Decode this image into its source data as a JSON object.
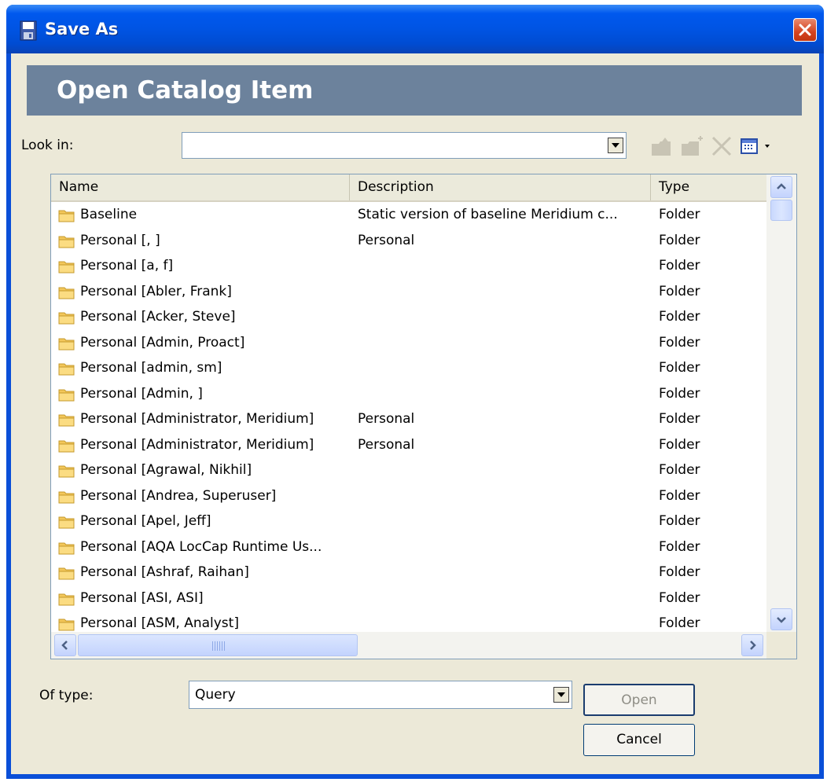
{
  "window": {
    "title": "Save As",
    "title_icon": "floppy-save-icon",
    "close_icon": "close-icon"
  },
  "header": {
    "title": "Open Catalog Item"
  },
  "lookin": {
    "label": "Look in:",
    "value": ""
  },
  "toolbar": {
    "icons": [
      "up-folder-icon",
      "new-folder-icon",
      "delete-icon",
      "view-menu-icon"
    ]
  },
  "list": {
    "columns": [
      "Name",
      "Description",
      "Type"
    ],
    "rows": [
      {
        "name": "Baseline",
        "description": "Static version of baseline Meridium c...",
        "type": "Folder"
      },
      {
        "name": "Personal [, ]",
        "description": "Personal",
        "type": "Folder"
      },
      {
        "name": "Personal [a, f]",
        "description": "",
        "type": "Folder"
      },
      {
        "name": "Personal [Abler, Frank]",
        "description": "",
        "type": "Folder"
      },
      {
        "name": "Personal [Acker, Steve]",
        "description": "",
        "type": "Folder"
      },
      {
        "name": "Personal [Admin, Proact]",
        "description": "",
        "type": "Folder"
      },
      {
        "name": "Personal [admin, sm]",
        "description": "",
        "type": "Folder"
      },
      {
        "name": "Personal [Admin, ]",
        "description": "",
        "type": "Folder"
      },
      {
        "name": "Personal [Administrator, Meridium]",
        "description": "Personal",
        "type": "Folder"
      },
      {
        "name": "Personal [Administrator, Meridium]",
        "description": "Personal",
        "type": "Folder"
      },
      {
        "name": "Personal [Agrawal, Nikhil]",
        "description": "",
        "type": "Folder"
      },
      {
        "name": "Personal [Andrea, Superuser]",
        "description": "",
        "type": "Folder"
      },
      {
        "name": "Personal [Apel, Jeff]",
        "description": "",
        "type": "Folder"
      },
      {
        "name": "Personal [AQA LocCap Runtime Us...",
        "description": "",
        "type": "Folder"
      },
      {
        "name": "Personal [Ashraf, Raihan]",
        "description": "",
        "type": "Folder"
      },
      {
        "name": "Personal [ASI, ASI]",
        "description": "",
        "type": "Folder"
      },
      {
        "name": "Personal [ASM, Analyst]",
        "description": "",
        "type": "Folder"
      }
    ]
  },
  "oftype": {
    "label": "Of type:",
    "value": "Query"
  },
  "buttons": {
    "open": "Open",
    "cancel": "Cancel"
  },
  "colors": {
    "titlebar": "#0054e3",
    "header_band": "#6c829c",
    "dialog_bg": "#ece9d8"
  }
}
